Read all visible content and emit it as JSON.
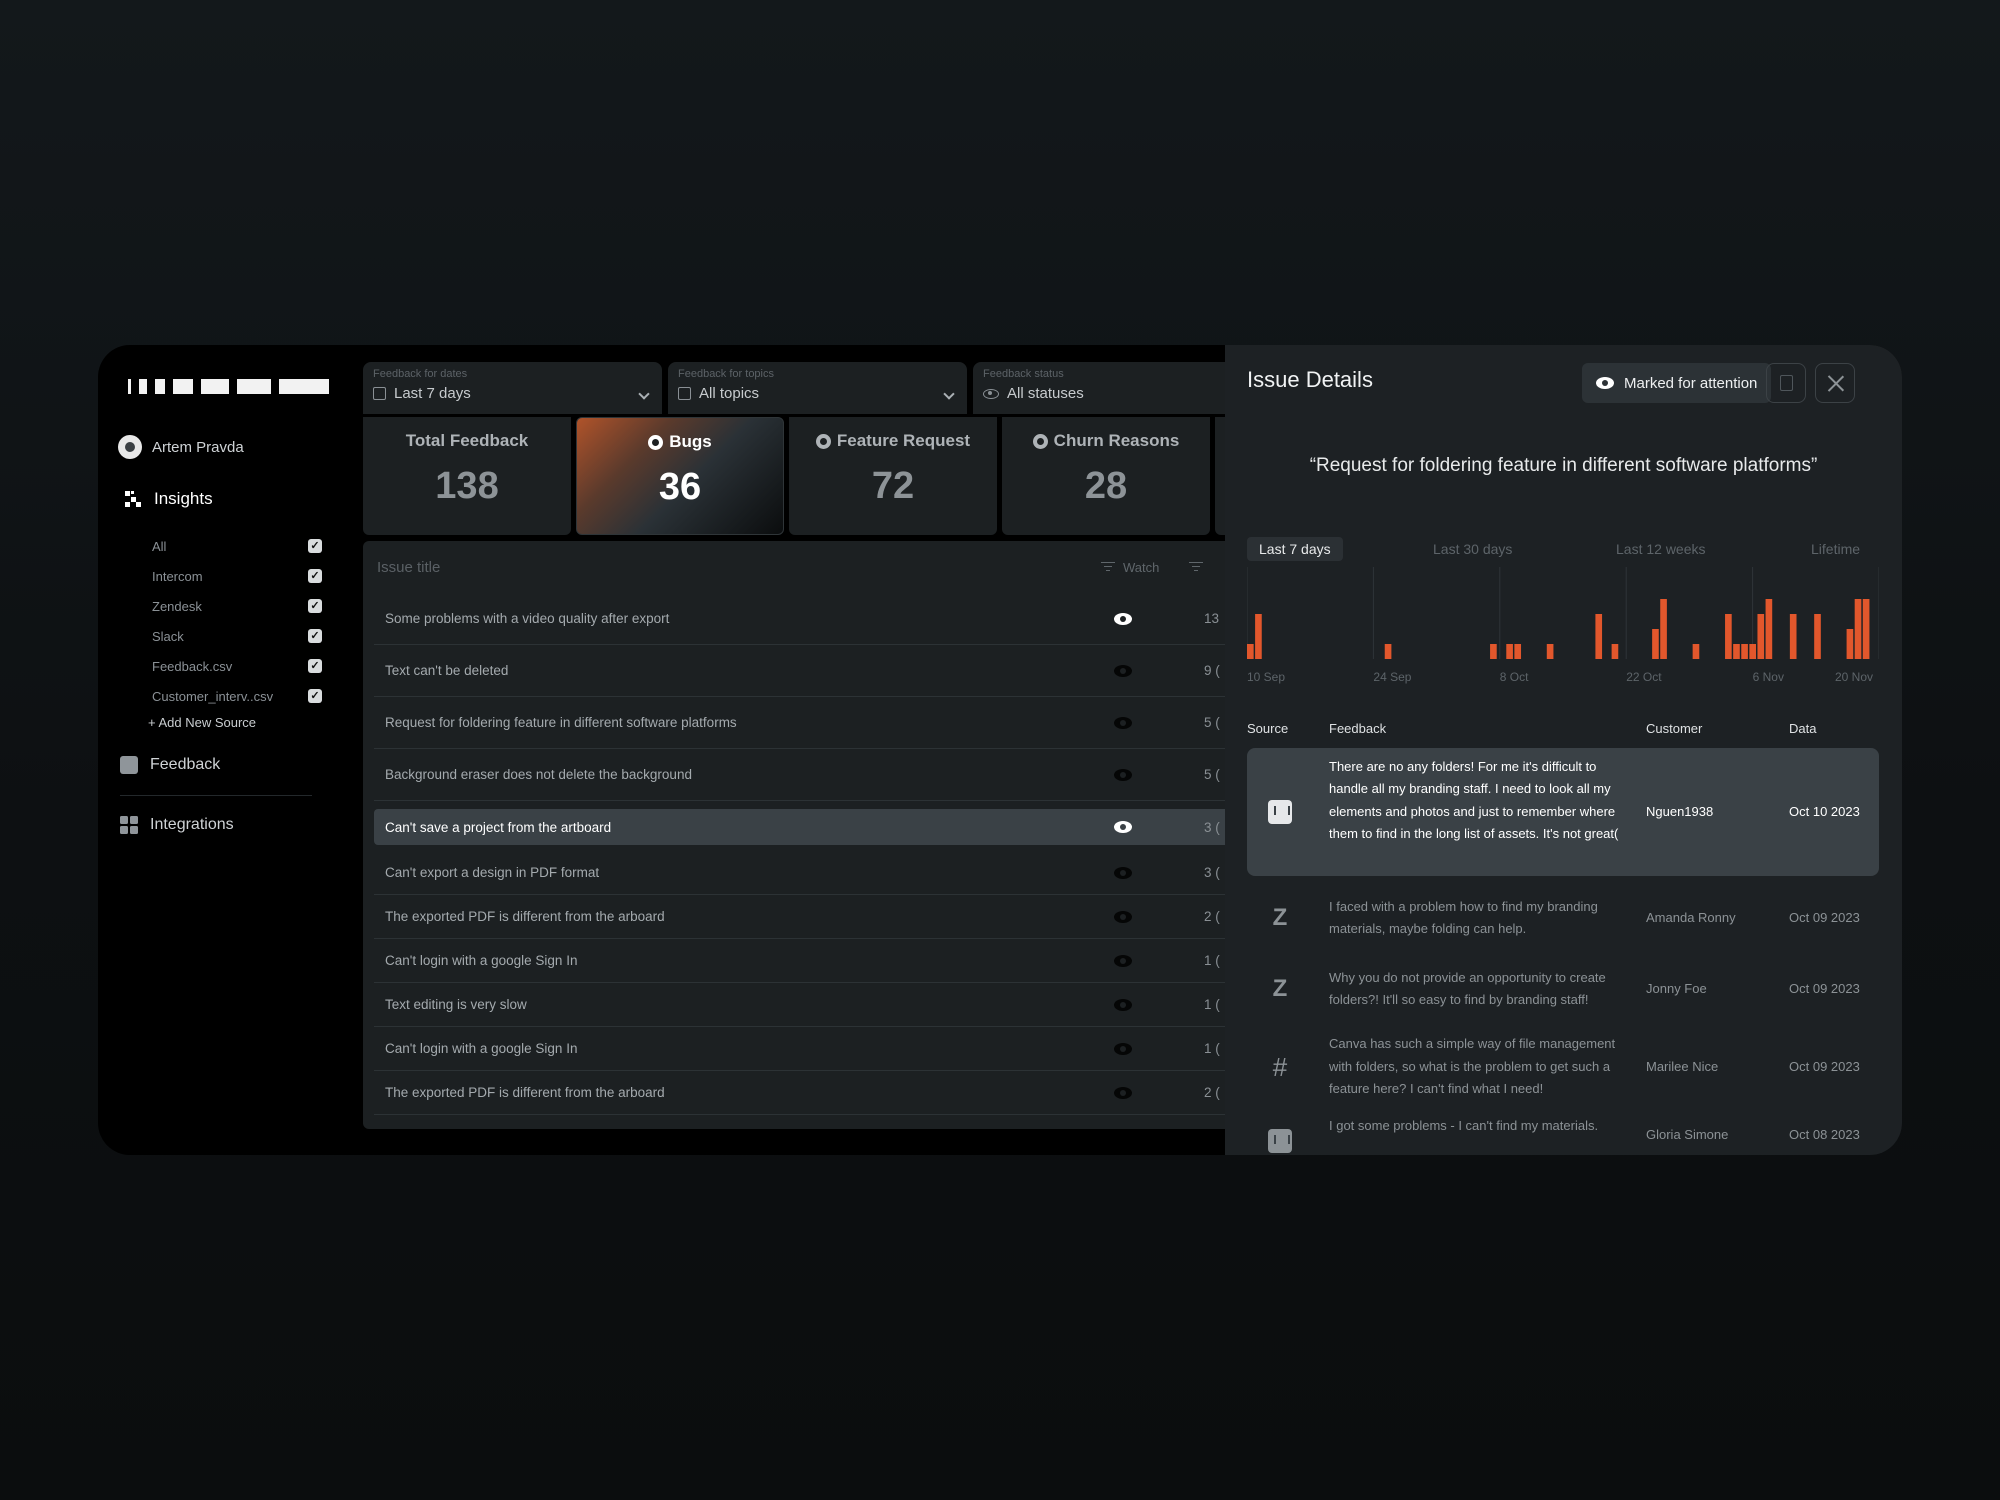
{
  "sidebar": {
    "user_name": "Artem Pravda",
    "insights_label": "Insights",
    "sources": [
      {
        "label": "All",
        "checked": true
      },
      {
        "label": "Intercom",
        "checked": true
      },
      {
        "label": "Zendesk",
        "checked": true
      },
      {
        "label": "Slack",
        "checked": true
      },
      {
        "label": "Feedback.csv",
        "checked": true
      },
      {
        "label": "Customer_interv..csv",
        "checked": true
      }
    ],
    "add_source_label": "+ Add New Source",
    "feedback_label": "Feedback",
    "integrations_label": "Integrations"
  },
  "filters": [
    {
      "label": "Feedback for dates",
      "value": "Last 7 days",
      "icon": "calendar-icon"
    },
    {
      "label": "Feedback for topics",
      "value": "All topics",
      "icon": "calendar-icon"
    },
    {
      "label": "Feedback status",
      "value": "All statuses",
      "icon": "eye-icon"
    }
  ],
  "stats": [
    {
      "name": "Total Feedback",
      "value": "138"
    },
    {
      "name": "Bugs",
      "value": "36",
      "active": true
    },
    {
      "name": "Feature Request",
      "value": "72"
    },
    {
      "name": "Churn Reasons",
      "value": "28"
    }
  ],
  "issues_table": {
    "header_title": "Issue title",
    "header_watch": "Watch",
    "rows": [
      {
        "title": "Some problems with a video quality after export",
        "count": "13"
      },
      {
        "title": "Text can't be deleted",
        "count": "9 ("
      },
      {
        "title": "Request for foldering feature in different software platforms",
        "count": "5 ("
      },
      {
        "title": "Background eraser does not delete the background",
        "count": "5 ("
      },
      {
        "title": "Can't save a project from the artboard",
        "count": "3 (",
        "selected": true
      },
      {
        "title": "Can't export a design in PDF format",
        "count": "3 ("
      },
      {
        "title": "The exported PDF is different from the arboard",
        "count": "2 ("
      },
      {
        "title": "Can't login with a google Sign In",
        "count": "1 ("
      },
      {
        "title": "Text editing is very slow",
        "count": "1 ("
      },
      {
        "title": "Can't login with a google Sign In",
        "count": "1 ("
      },
      {
        "title": "The exported PDF is different from the arboard",
        "count": "2 ("
      }
    ]
  },
  "issue_details": {
    "title": "Issue Details",
    "marked_label": "Marked for attention",
    "quote": "“Request for foldering feature in different software platforms”",
    "tabs": [
      "Last 7 days",
      "Last 30 days",
      "Last 12 weeks",
      "Lifetime"
    ],
    "active_tab": "Last 7 days",
    "bar_color": "#e2572c",
    "table_headers": {
      "source": "Source",
      "feedback": "Feedback",
      "customer": "Customer",
      "date": "Data"
    },
    "feedback_rows": [
      {
        "source_icon": "intercom-icon",
        "text": "There are no any folders! For me it's difficult to handle all my branding staff. I need to look all my elements and photos and just to remember where them to find in the long list of assets. It's not great(",
        "customer": "Nguen1938",
        "date": "Oct 10 2023",
        "selected": true
      },
      {
        "source_icon": "zendesk-icon",
        "text": "I faced with a problem how to find my branding materials, maybe folding can help.",
        "customer": "Amanda Ronny",
        "date": "Oct 09 2023"
      },
      {
        "source_icon": "zendesk-icon",
        "text": "Why you do not provide an opportunity to create folders?! It'll so easy to find by branding staff!",
        "customer": "Jonny Foe",
        "date": "Oct 09 2023"
      },
      {
        "source_icon": "slack-icon",
        "text": "Canva has such a simple way of file management with folders, so what is the problem to get such a feature here? I can't find what I need!",
        "customer": "Marilee Nice",
        "date": "Oct 09 2023"
      },
      {
        "source_icon": "intercom-icon",
        "text": "I got some problems - I can't find my materials.",
        "customer": "Gloria Simone",
        "date": "Oct 08 2023"
      }
    ]
  },
  "chart_data": {
    "type": "bar",
    "x_ticks": [
      "10 Sep",
      "24 Sep",
      "8 Oct",
      "22 Oct",
      "6 Nov",
      "20 Nov"
    ],
    "values": [
      1,
      3,
      0,
      0,
      0,
      0,
      0,
      0,
      0,
      0,
      0,
      0,
      0,
      0,
      0,
      0,
      0,
      1,
      0,
      0,
      0,
      0,
      0,
      0,
      0,
      0,
      0,
      0,
      0,
      0,
      1,
      0,
      1,
      1,
      0,
      0,
      0,
      1,
      0,
      0,
      0,
      0,
      0,
      3,
      0,
      1,
      0,
      0,
      0,
      0,
      2,
      4,
      0,
      0,
      0,
      1,
      0,
      0,
      0,
      3,
      1,
      1,
      1,
      3,
      4,
      0,
      0,
      3,
      0,
      0,
      3,
      0,
      0,
      0,
      2,
      4,
      4,
      0
    ],
    "ylim": [
      0,
      4
    ],
    "grid": true,
    "legend": "none"
  }
}
